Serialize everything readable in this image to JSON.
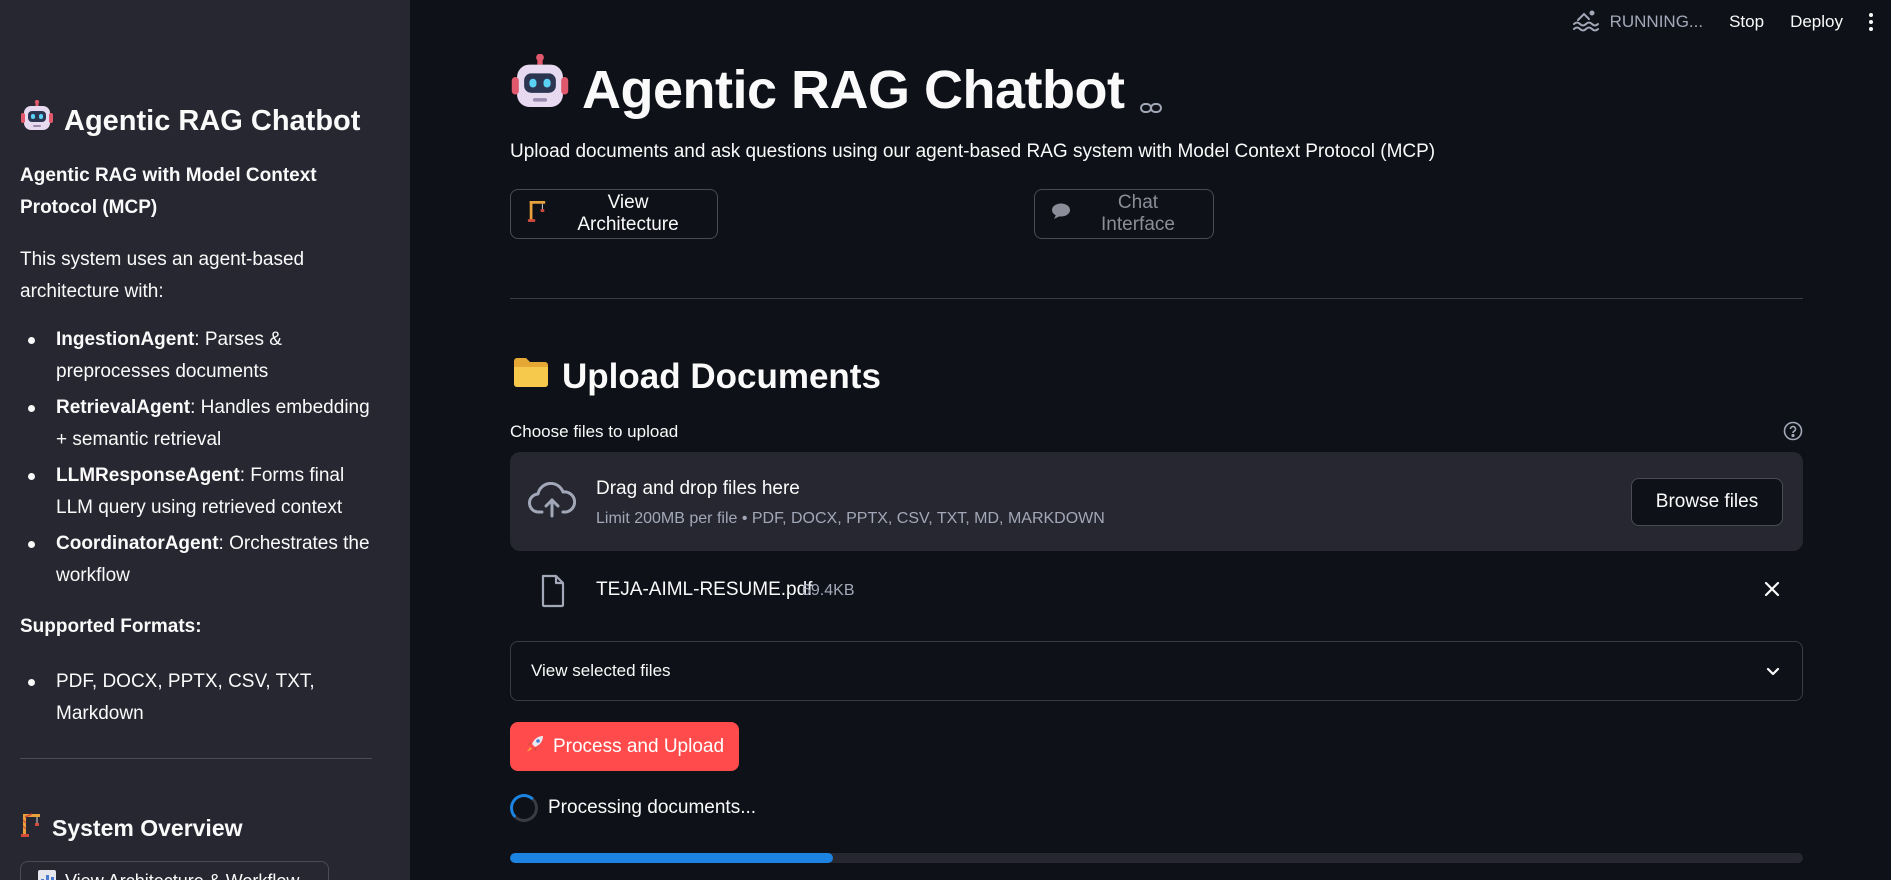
{
  "sidebar": {
    "title": "Agentic RAG Chatbot",
    "subtitle": "Agentic RAG with Model Context Protocol (MCP)",
    "description": "This system uses an agent-based architecture with:",
    "agents": [
      {
        "name": "IngestionAgent",
        "desc": ": Parses & preprocesses documents"
      },
      {
        "name": "RetrievalAgent",
        "desc": ": Handles embedding + semantic retrieval"
      },
      {
        "name": "LLMResponseAgent",
        "desc": ": Forms final LLM query using retrieved context"
      },
      {
        "name": "CoordinatorAgent",
        "desc": ": Orchestrates the workflow"
      }
    ],
    "formats_title": "Supported Formats:",
    "formats": [
      "PDF, DOCX, PPTX, CSV, TXT, Markdown"
    ],
    "overview_title": "System Overview",
    "view_button": "View Architecture & Workflow"
  },
  "header": {
    "status": "RUNNING...",
    "stop": "Stop",
    "deploy": "Deploy"
  },
  "main": {
    "title": "Agentic RAG Chatbot",
    "intro": "Upload documents and ask questions using our agent-based RAG system with Model Context Protocol (MCP)",
    "view_arch_button": "View Architecture",
    "chat_button": "Chat Interface",
    "upload_title": "Upload Documents",
    "choose_label": "Choose files to upload",
    "dropzone_title": "Drag and drop files here",
    "dropzone_limit": "Limit 200MB per file • PDF, DOCX, PPTX, CSV, TXT, MD, MARKDOWN",
    "browse_button": "Browse files",
    "file": {
      "name": "TEJA-AIML-RESUME.pdf",
      "size": "69.4KB"
    },
    "expander_label": "View selected files",
    "process_button": "Process and Upload",
    "processing_text": "Processing documents...",
    "progress": 0.25
  },
  "colors": {
    "accent": "#ff4b4b",
    "progress": "#1c83e1",
    "background": "#0e1117",
    "sidebar": "#262730"
  }
}
